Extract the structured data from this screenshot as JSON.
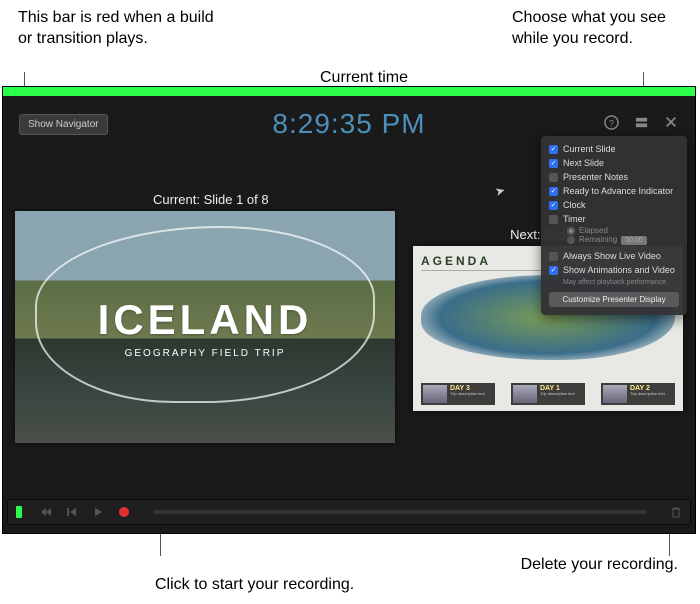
{
  "callouts": {
    "top_left": "This bar is red when a build or transition plays.",
    "top_mid": "Current time",
    "top_right": "Choose what you see while you record.",
    "bottom_left": "Click to start your recording.",
    "bottom_right": "Delete your recording."
  },
  "toolbar": {
    "show_navigator": "Show Navigator"
  },
  "clock": {
    "time": "8:29:35 PM"
  },
  "labels": {
    "current": "Current: Slide 1 of 8",
    "next": "Next: Slide"
  },
  "current_slide": {
    "title": "ICELAND",
    "subtitle": "GEOGRAPHY FIELD TRIP"
  },
  "next_slide": {
    "heading": "AGENDA",
    "days": [
      {
        "label": "DAY 3",
        "desc": "Trip description text"
      },
      {
        "label": "DAY 1",
        "desc": "Trip description text"
      },
      {
        "label": "DAY 2",
        "desc": "Trip description text"
      }
    ]
  },
  "popover": {
    "items": [
      {
        "label": "Current Slide",
        "checked": true
      },
      {
        "label": "Next Slide",
        "checked": true
      },
      {
        "label": "Presenter Notes",
        "checked": false
      },
      {
        "label": "Ready to Advance Indicator",
        "checked": true
      },
      {
        "label": "Clock",
        "checked": true
      },
      {
        "label": "Timer",
        "checked": false
      }
    ],
    "timer_options": {
      "elapsed": "Elapsed",
      "remaining": "Remaining",
      "value": "00:00"
    },
    "always_live": {
      "label": "Always Show Live Video",
      "checked": false
    },
    "show_anim": {
      "label": "Show Animations and Video",
      "checked": true
    },
    "note": "May affect playback performance.",
    "customize": "Customize Presenter Display"
  }
}
